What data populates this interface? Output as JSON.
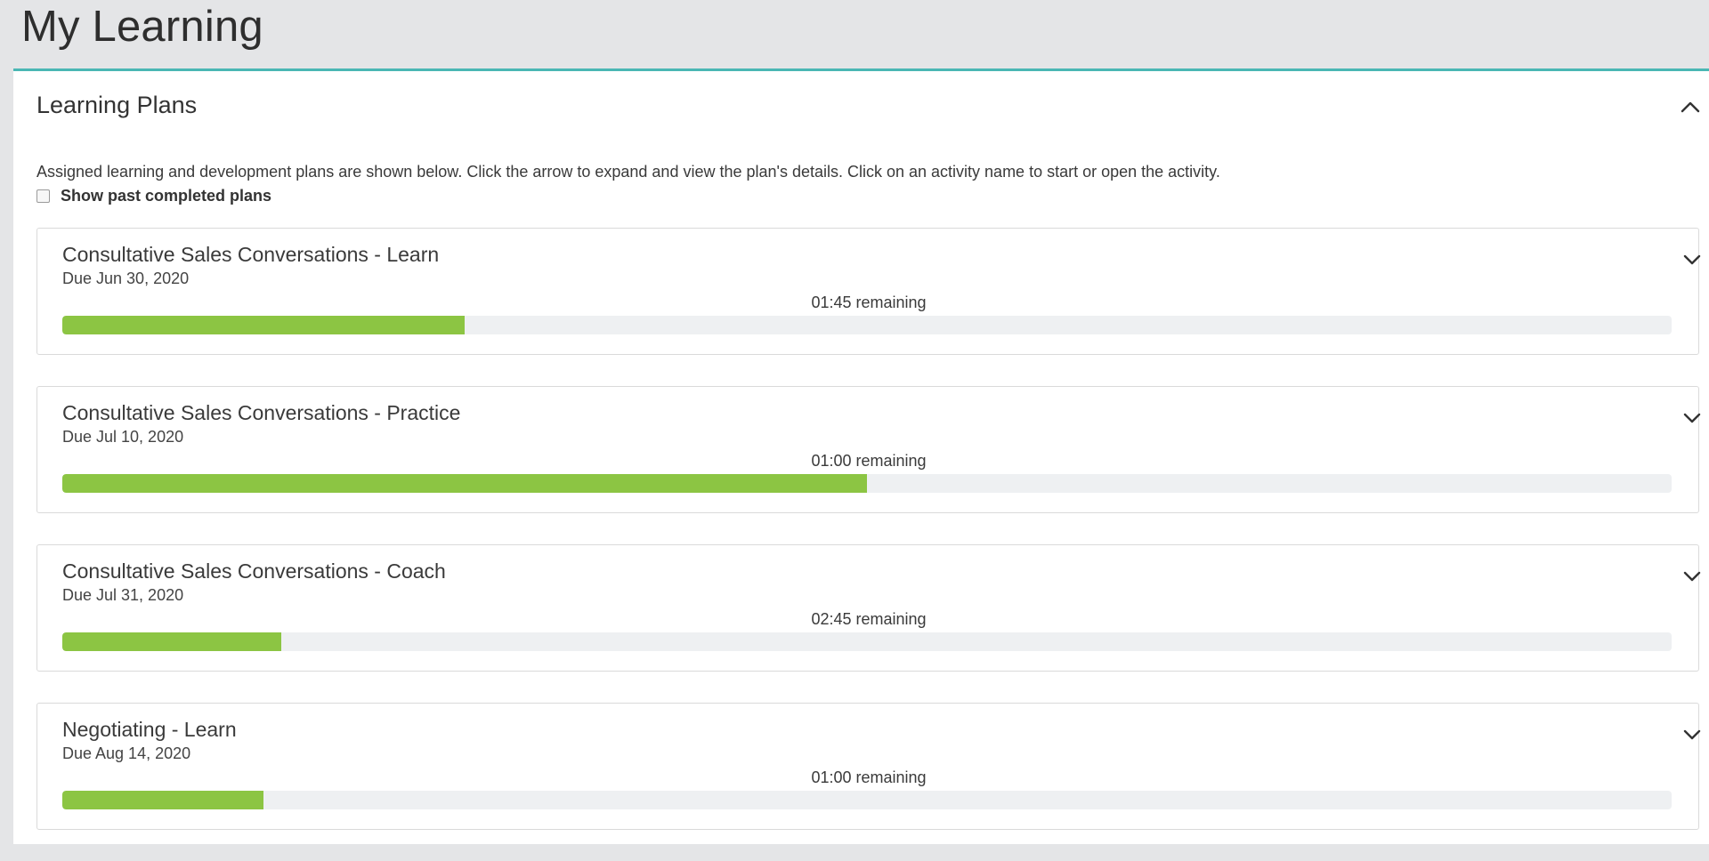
{
  "page": {
    "title": "My Learning"
  },
  "panel": {
    "title": "Learning Plans",
    "collapse_icon": "chevron-up-icon",
    "description": "Assigned learning and development plans are shown below. Click the arrow to expand and view the plan's details. Click on an activity name to start or open the activity.",
    "show_past_label": "Show past completed plans",
    "show_past_checked": false
  },
  "plans": [
    {
      "name": "Consultative Sales Conversations - Learn",
      "due": "Due Jun 30, 2020",
      "remaining": "01:45 remaining",
      "progress": 0.25,
      "expand_icon": "chevron-down-icon"
    },
    {
      "name": "Consultative Sales Conversations - Practice",
      "due": "Due Jul 10, 2020",
      "remaining": "01:00 remaining",
      "progress": 0.5,
      "expand_icon": "chevron-down-icon"
    },
    {
      "name": "Consultative Sales Conversations - Coach",
      "due": "Due Jul 31, 2020",
      "remaining": "02:45 remaining",
      "progress": 0.136,
      "expand_icon": "chevron-down-icon"
    },
    {
      "name": "Negotiating - Learn",
      "due": "Due Aug 14, 2020",
      "remaining": "01:00 remaining",
      "progress": 0.125,
      "expand_icon": "chevron-down-icon"
    }
  ],
  "colors": {
    "accent": "#4ab7b4",
    "progress_fill": "#8cc543",
    "progress_track": "#eef0f2"
  }
}
